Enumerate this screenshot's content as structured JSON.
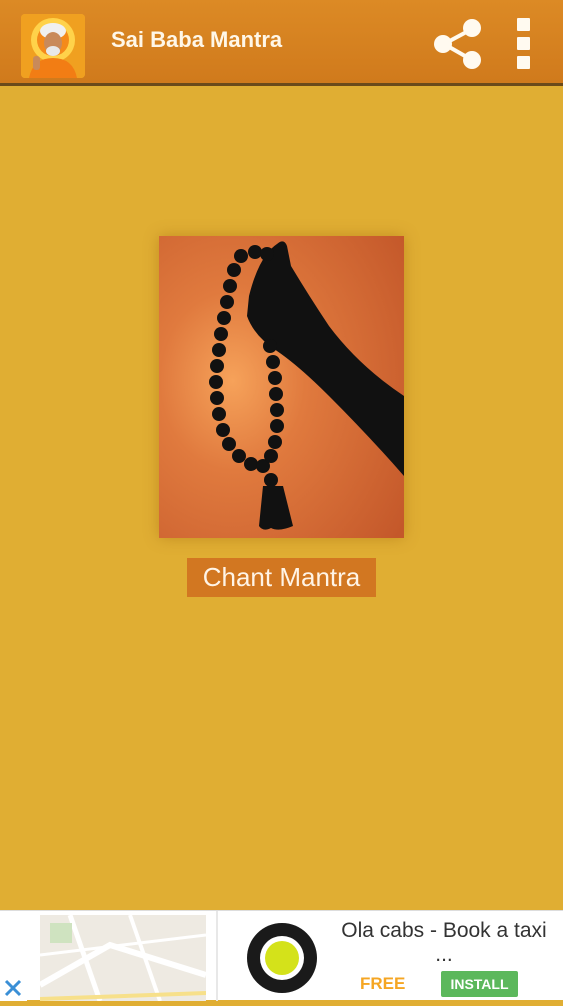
{
  "appbar": {
    "title": "Sai Baba Mantra",
    "app_icon": "sai-baba-portrait-icon",
    "share_icon": "share-icon",
    "overflow_icon": "more-vert-icon",
    "color": "#d4801f"
  },
  "main": {
    "image_icon": "mala-beads-hand-image",
    "chant_button_label": "Chant Mantra",
    "background_color": "#e0ae33",
    "button_color": "#d27721"
  },
  "ad": {
    "title": "Ola cabs - Book a taxi",
    "ellipsis": "...",
    "price_label": "FREE",
    "install_label": "INSTALL",
    "close_icon": "close-icon",
    "logo_icon": "ola-logo-icon",
    "map_icon": "map-thumbnail"
  }
}
